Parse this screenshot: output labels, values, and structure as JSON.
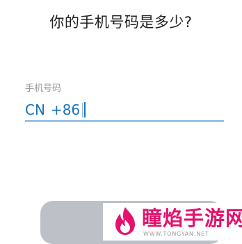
{
  "header": {
    "title": "你的手机号码是多少?"
  },
  "phone_field": {
    "label": "手机号码",
    "country_code": "CN",
    "dial_code": "+86",
    "value": "",
    "accent_color": "#1a73b8"
  },
  "next_button": {
    "label": "",
    "state": "disabled",
    "color": "#bdc1c7"
  },
  "watermark": {
    "brand": "瞳焰手游网",
    "url": "WWW.TONGYAN.NET",
    "brand_color": "#e2126e",
    "logo_icon": "flame-logo-icon"
  }
}
